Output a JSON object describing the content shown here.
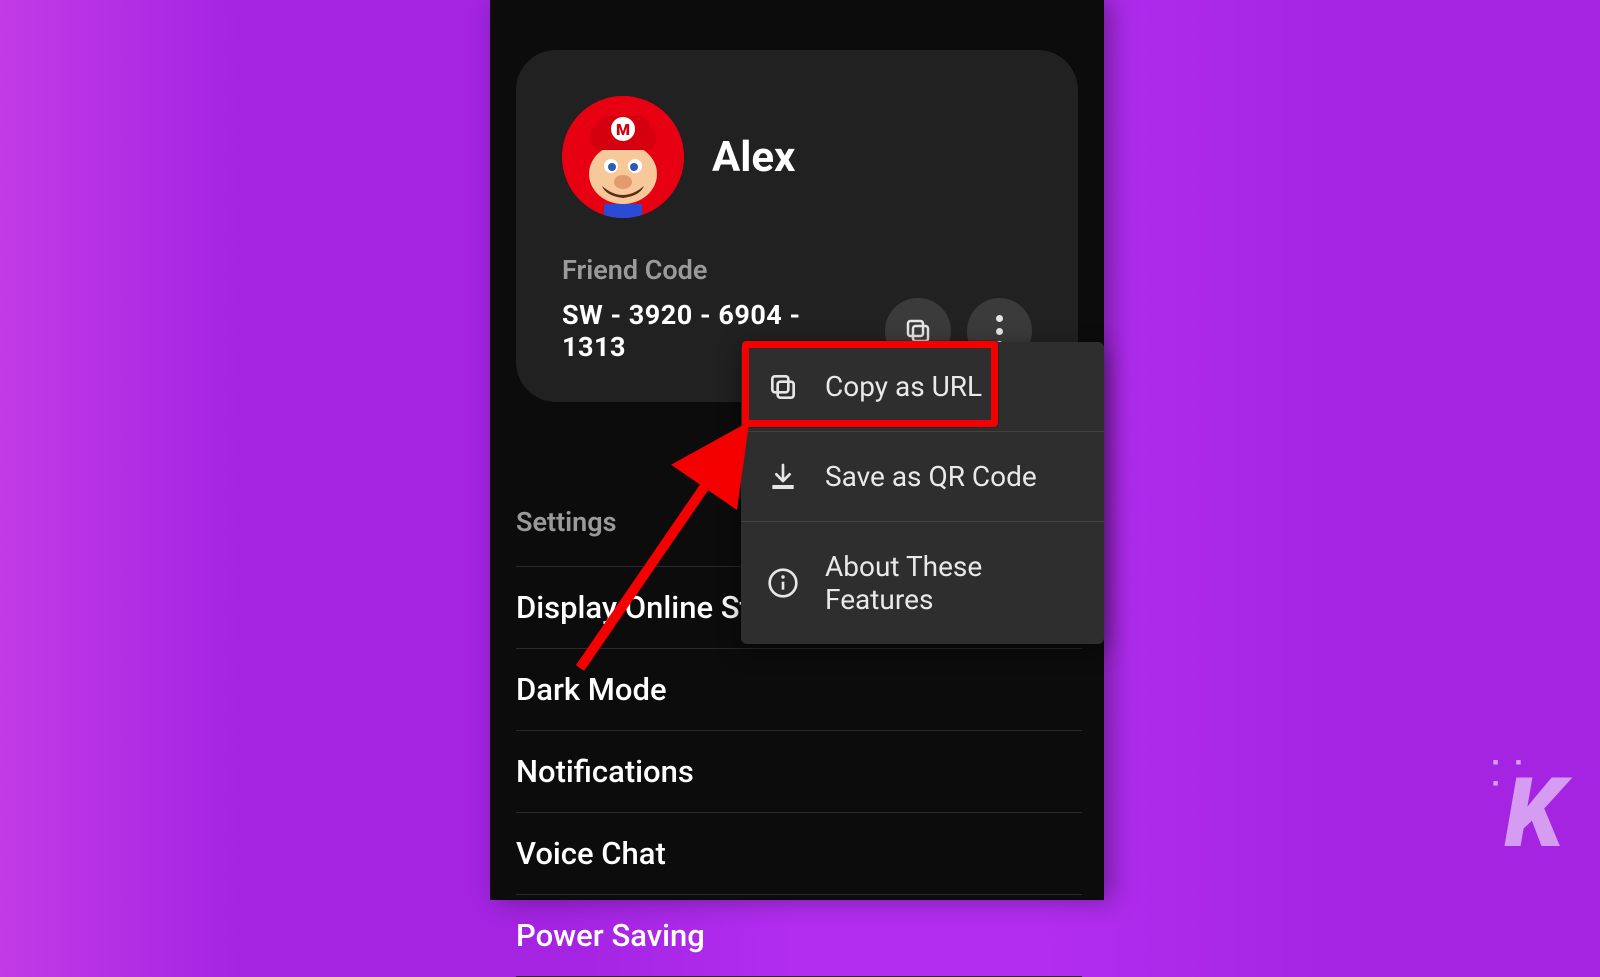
{
  "profile": {
    "name": "Alex",
    "friend_code_label": "Friend Code",
    "friend_code_value": "SW - 3920 - 6904 - 1313"
  },
  "icon_buttons": {
    "copy": "copy-icon",
    "more": "more-vertical-icon"
  },
  "popover": {
    "items": [
      {
        "icon": "copy-icon",
        "label": "Copy as URL"
      },
      {
        "icon": "download-icon",
        "label": "Save as QR Code"
      },
      {
        "icon": "info-icon",
        "label": "About These Features"
      }
    ]
  },
  "settings": {
    "heading": "Settings",
    "items": [
      "Display Online Status",
      "Dark Mode",
      "Notifications",
      "Voice Chat",
      "Power Saving"
    ]
  },
  "watermark": "K",
  "colors": {
    "highlight": "#f50000",
    "bg_dark": "#0c0c0c",
    "card": "#212121",
    "popover": "#2e2e2e",
    "avatar": "#e60012"
  }
}
